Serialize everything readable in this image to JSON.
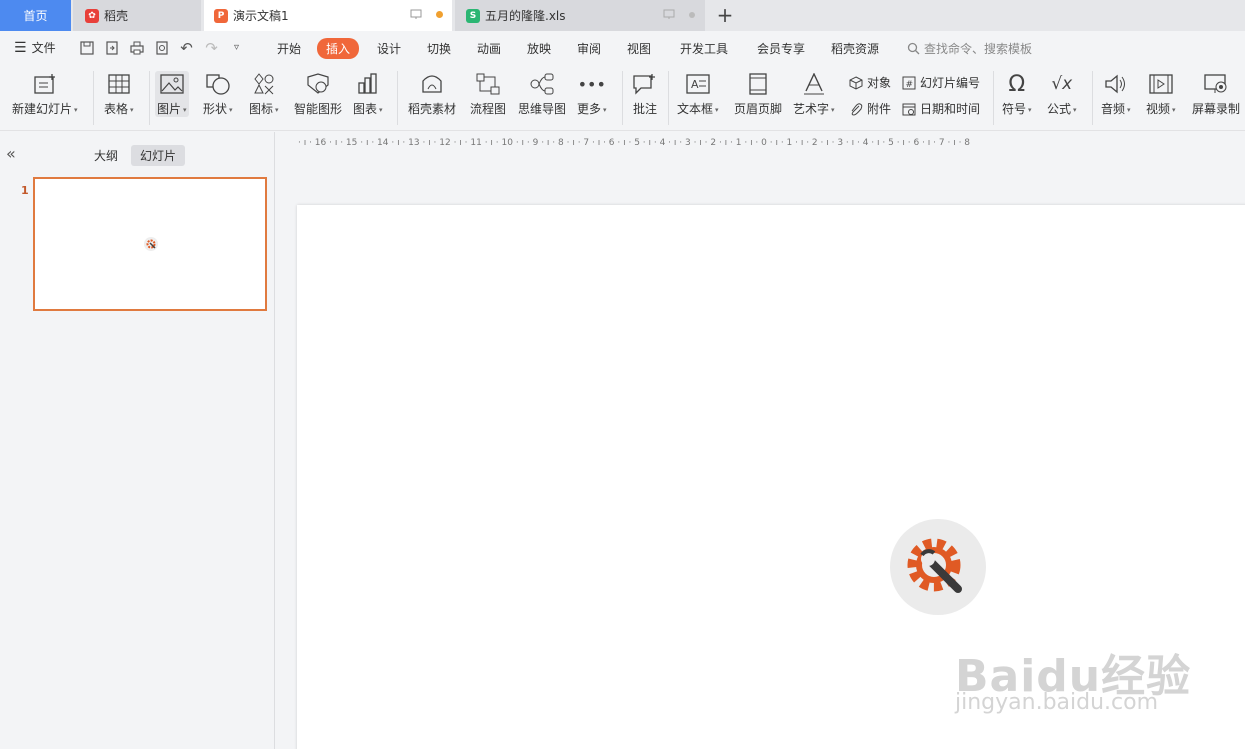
{
  "tabs": {
    "home": "首页",
    "daoke": "稻壳",
    "doc": "演示文稿1",
    "xls": "五月的隆隆.xls",
    "new_tab": "+"
  },
  "menu": {
    "file": "文件",
    "tabs": [
      "开始",
      "插入",
      "设计",
      "切换",
      "动画",
      "放映",
      "审阅",
      "视图",
      "开发工具",
      "会员专享",
      "稻壳资源"
    ],
    "active": "插入",
    "search_placeholder": "查找命令、搜索模板"
  },
  "ribbon": {
    "new_slide": "新建幻灯片",
    "table": "表格",
    "picture": "图片",
    "shape": "形状",
    "icons": "图标",
    "smartart": "智能图形",
    "chart": "图表",
    "material": "稻壳素材",
    "flowchart": "流程图",
    "mindmap": "思维导图",
    "more": "更多",
    "comment": "批注",
    "textbox": "文本框",
    "header_footer": "页眉页脚",
    "wordart": "艺术字",
    "object": "对象",
    "attachment": "附件",
    "slide_number": "幻灯片编号",
    "datetime": "日期和时间",
    "symbol": "符号",
    "formula": "公式",
    "audio": "音频",
    "video": "视频",
    "screen_record": "屏幕录制"
  },
  "panel": {
    "outline": "大纲",
    "slides": "幻灯片",
    "slide_number": "1"
  },
  "ruler_text": "· ı · 16 · ı · 15 · ı · 14 · ı · 13 · ı · 12 · ı · 11 · ı · 10 · ı · 9 · ı · 8 · ı · 7 · ı · 6 · ı · 5 · ı · 4 · ı · 3 · ı · 2 · ı · 1 · ı · 0 · ı · 1 · ı · 2 · ı · 3 · ı · 4 · ı · 5 · ı · 6 · ı · 7 · ı · 8",
  "watermark": {
    "brand": "Baidu经验",
    "url": "jingyan.baidu.com"
  },
  "colors": {
    "accent": "#f0673a",
    "home_tab": "#4d8af0",
    "slide_border": "#e07a3f"
  }
}
